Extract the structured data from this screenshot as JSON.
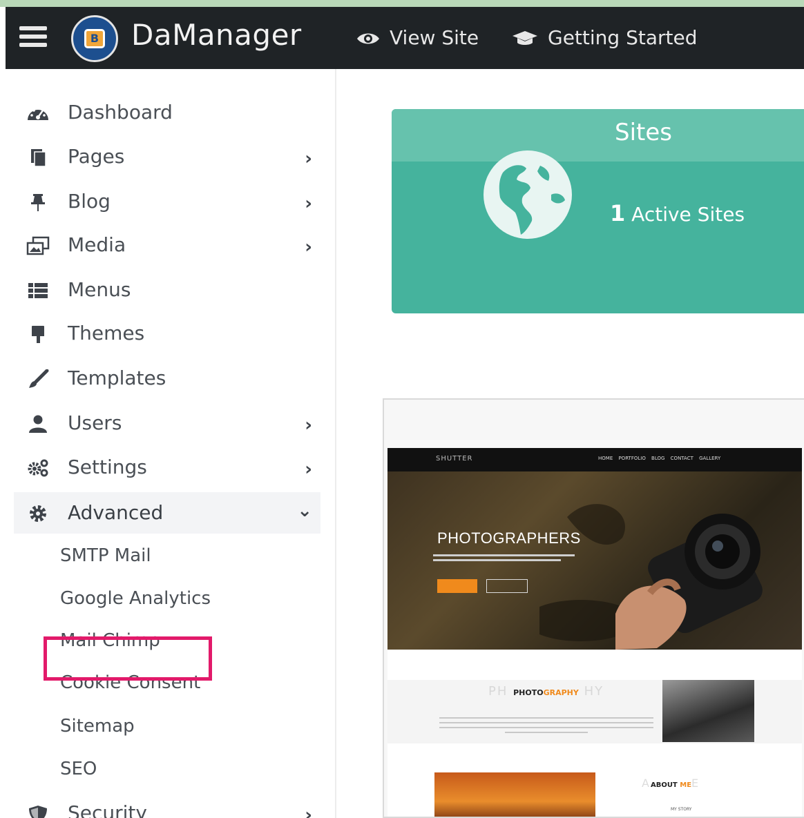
{
  "header": {
    "brand": "DaManager",
    "logo_letter": "B",
    "view_site": "View Site",
    "getting_started": "Getting Started"
  },
  "sidebar": {
    "items": [
      {
        "label": "Dashboard",
        "icon": "dashboard-icon",
        "has_submenu": false
      },
      {
        "label": "Pages",
        "icon": "pages-icon",
        "has_submenu": true
      },
      {
        "label": "Blog",
        "icon": "pin-icon",
        "has_submenu": true
      },
      {
        "label": "Media",
        "icon": "media-icon",
        "has_submenu": true
      },
      {
        "label": "Menus",
        "icon": "list-icon",
        "has_submenu": false
      },
      {
        "label": "Themes",
        "icon": "paint-roller-icon",
        "has_submenu": false
      },
      {
        "label": "Templates",
        "icon": "brush-icon",
        "has_submenu": false
      },
      {
        "label": "Users",
        "icon": "user-icon",
        "has_submenu": true
      },
      {
        "label": "Settings",
        "icon": "cogs-icon",
        "has_submenu": true
      },
      {
        "label": "Advanced",
        "icon": "cog-icon",
        "has_submenu": true,
        "expanded": true
      },
      {
        "label": "Security",
        "icon": "shield-icon",
        "has_submenu": true
      }
    ],
    "advanced_sub": [
      "SMTP Mail",
      "Google Analytics",
      "Mail Chimp",
      "Cookie Consent",
      "Sitemap",
      "SEO"
    ],
    "highlighted": "Sitemap",
    "chevron_right": "›",
    "chevron_down": "⌄"
  },
  "sites_card": {
    "title": "Sites",
    "count": "1",
    "count_label": "Active Sites"
  },
  "preview": {
    "brand": "SHUTTER",
    "menu": "HOME PORTFOLIO BLOG CONTACT GALLERY",
    "hero_title": "PHOTOGRAPHERS",
    "section_title_left": "PH",
    "section_title_mid": "PHOTO",
    "section_title_mid_accent": "GRAPHY",
    "section_title_right": "HY",
    "about_left": "A",
    "about_mid": "ABOUT",
    "about_mid_accent": " ME",
    "about_right": "E",
    "about_sub": "MY STORY"
  },
  "colors": {
    "topbar": "#1f2326",
    "card": "#45b39d",
    "card_header": "#66c2ad",
    "highlight": "#e21a6a"
  }
}
